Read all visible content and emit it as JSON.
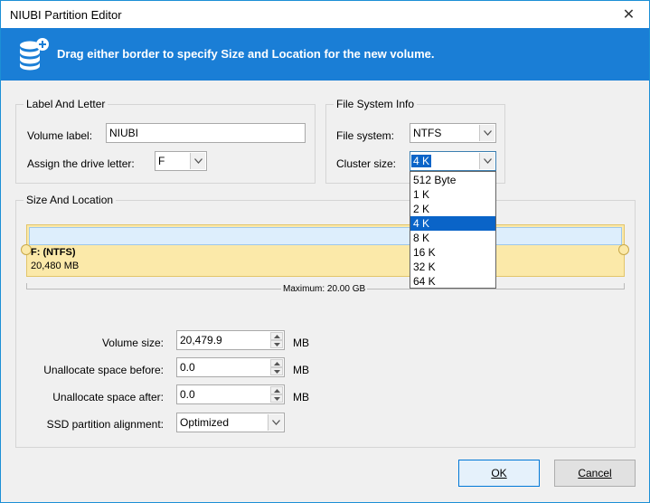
{
  "window": {
    "title": "NIUBI Partition Editor",
    "close_glyph": "✕"
  },
  "banner": {
    "icon": "database-add-icon",
    "text": "Drag either border to specify Size and Location for the new volume.",
    "color": "#1a7ed6"
  },
  "label_letter": {
    "legend": "Label And Letter",
    "volume_label_caption": "Volume label:",
    "volume_label_value": "NIUBI",
    "drive_letter_caption": "Assign the drive letter:",
    "drive_letter_value": "F"
  },
  "fs_info": {
    "legend": "File System Info",
    "file_system_caption": "File system:",
    "file_system_value": "NTFS",
    "cluster_size_caption": "Cluster size:",
    "cluster_size_value": "4 K",
    "cluster_options": [
      "512 Byte",
      "1 K",
      "2 K",
      "4 K",
      "8 K",
      "16 K",
      "32 K",
      "64 K"
    ],
    "cluster_selected_index": 3
  },
  "size_location": {
    "legend": "Size And Location",
    "partition_name": "F: (NTFS)",
    "partition_size": "20,480 MB",
    "maximum": "Maximum: 20.00 GB",
    "volume_size_caption": "Volume size:",
    "volume_size_value": "20,479.9",
    "unalloc_before_caption": "Unallocate space before:",
    "unalloc_before_value": "0.0",
    "unalloc_after_caption": "Unallocate space after:",
    "unalloc_after_value": "0.0",
    "unit": "MB",
    "ssd_caption": "SSD partition alignment:",
    "ssd_value": "Optimized"
  },
  "buttons": {
    "ok": "OK",
    "cancel": "Cancel"
  }
}
